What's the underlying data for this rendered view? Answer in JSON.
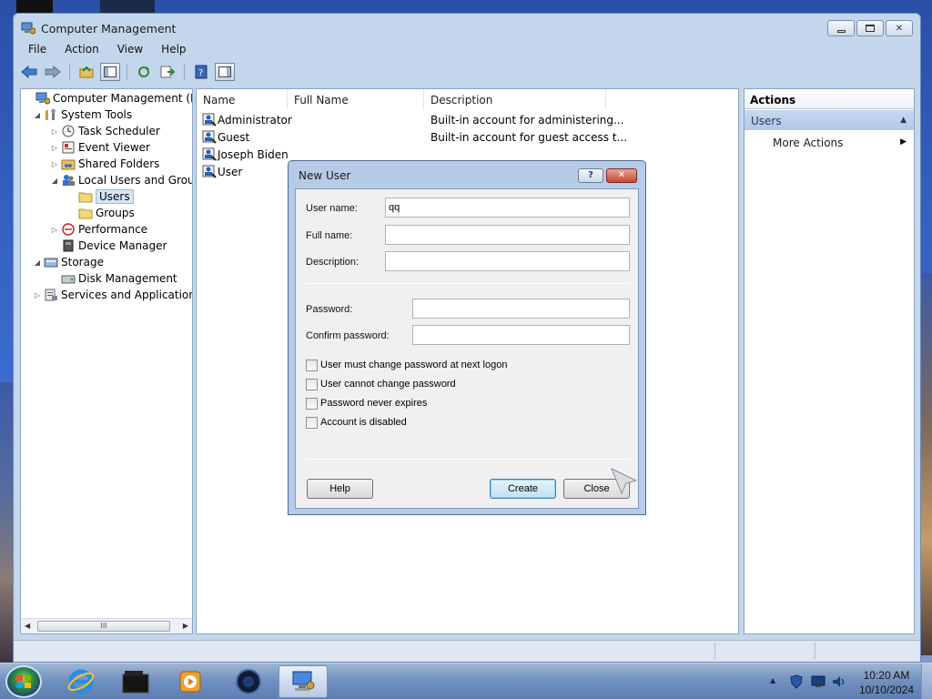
{
  "window": {
    "title": "Computer Management",
    "controls": {
      "minimize": "—",
      "maximize": "▫",
      "close": "✕"
    }
  },
  "menu": [
    "File",
    "Action",
    "View",
    "Help"
  ],
  "tree": {
    "items": [
      {
        "label": "Computer Management (Local",
        "level": 0,
        "expander": "",
        "icon": "computer-management-icon"
      },
      {
        "label": "System Tools",
        "level": 1,
        "expander": "◢",
        "icon": "system-tools-icon"
      },
      {
        "label": "Task Scheduler",
        "level": 2,
        "expander": "▷",
        "icon": "task-scheduler-icon"
      },
      {
        "label": "Event Viewer",
        "level": 2,
        "expander": "▷",
        "icon": "event-viewer-icon"
      },
      {
        "label": "Shared Folders",
        "level": 2,
        "expander": "▷",
        "icon": "shared-folders-icon"
      },
      {
        "label": "Local Users and Groups",
        "level": 2,
        "expander": "◢",
        "icon": "local-users-icon"
      },
      {
        "label": "Users",
        "level": 3,
        "expander": "",
        "icon": "folder-icon",
        "selected": true
      },
      {
        "label": "Groups",
        "level": 3,
        "expander": "",
        "icon": "folder-icon"
      },
      {
        "label": "Performance",
        "level": 2,
        "expander": "▷",
        "icon": "performance-icon"
      },
      {
        "label": "Device Manager",
        "level": 2,
        "expander": "",
        "icon": "device-manager-icon"
      },
      {
        "label": "Storage",
        "level": 1,
        "expander": "◢",
        "icon": "storage-icon"
      },
      {
        "label": "Disk Management",
        "level": 2,
        "expander": "",
        "icon": "disk-management-icon"
      },
      {
        "label": "Services and Applications",
        "level": 1,
        "expander": "▷",
        "icon": "services-icon"
      }
    ],
    "scroll_thumb_label": "III"
  },
  "list": {
    "columns": [
      "Name",
      "Full Name",
      "Description"
    ],
    "rows": [
      {
        "name": "Administrator",
        "full_name": "",
        "description": "Built-in account for administering..."
      },
      {
        "name": "Guest",
        "full_name": "",
        "description": "Built-in account for guest access t..."
      },
      {
        "name": "Joseph Biden",
        "full_name": "",
        "description": ""
      },
      {
        "name": "User",
        "full_name": "",
        "description": ""
      }
    ]
  },
  "actions": {
    "header": "Actions",
    "section": "Users",
    "more_actions": "More Actions"
  },
  "dialog": {
    "title": "New User",
    "help_glyph": "?",
    "close_glyph": "✕",
    "labels": {
      "user_name": "User name:",
      "full_name": "Full name:",
      "description": "Description:",
      "password": "Password:",
      "confirm_password": "Confirm password:"
    },
    "values": {
      "user_name": "qq",
      "full_name": "",
      "description": "",
      "password": "",
      "confirm_password": ""
    },
    "checkboxes": [
      {
        "label": "User must change password at next logon",
        "checked": false
      },
      {
        "label": "User cannot change password",
        "checked": false
      },
      {
        "label": "Password never expires",
        "checked": false
      },
      {
        "label": "Account is disabled",
        "checked": false
      }
    ],
    "buttons": {
      "help": "Help",
      "create": "Create",
      "close": "Close"
    }
  },
  "taskbar": {
    "time": "10:20 AM",
    "date": "10/10/2024",
    "tray_up_arrow": "▲"
  }
}
